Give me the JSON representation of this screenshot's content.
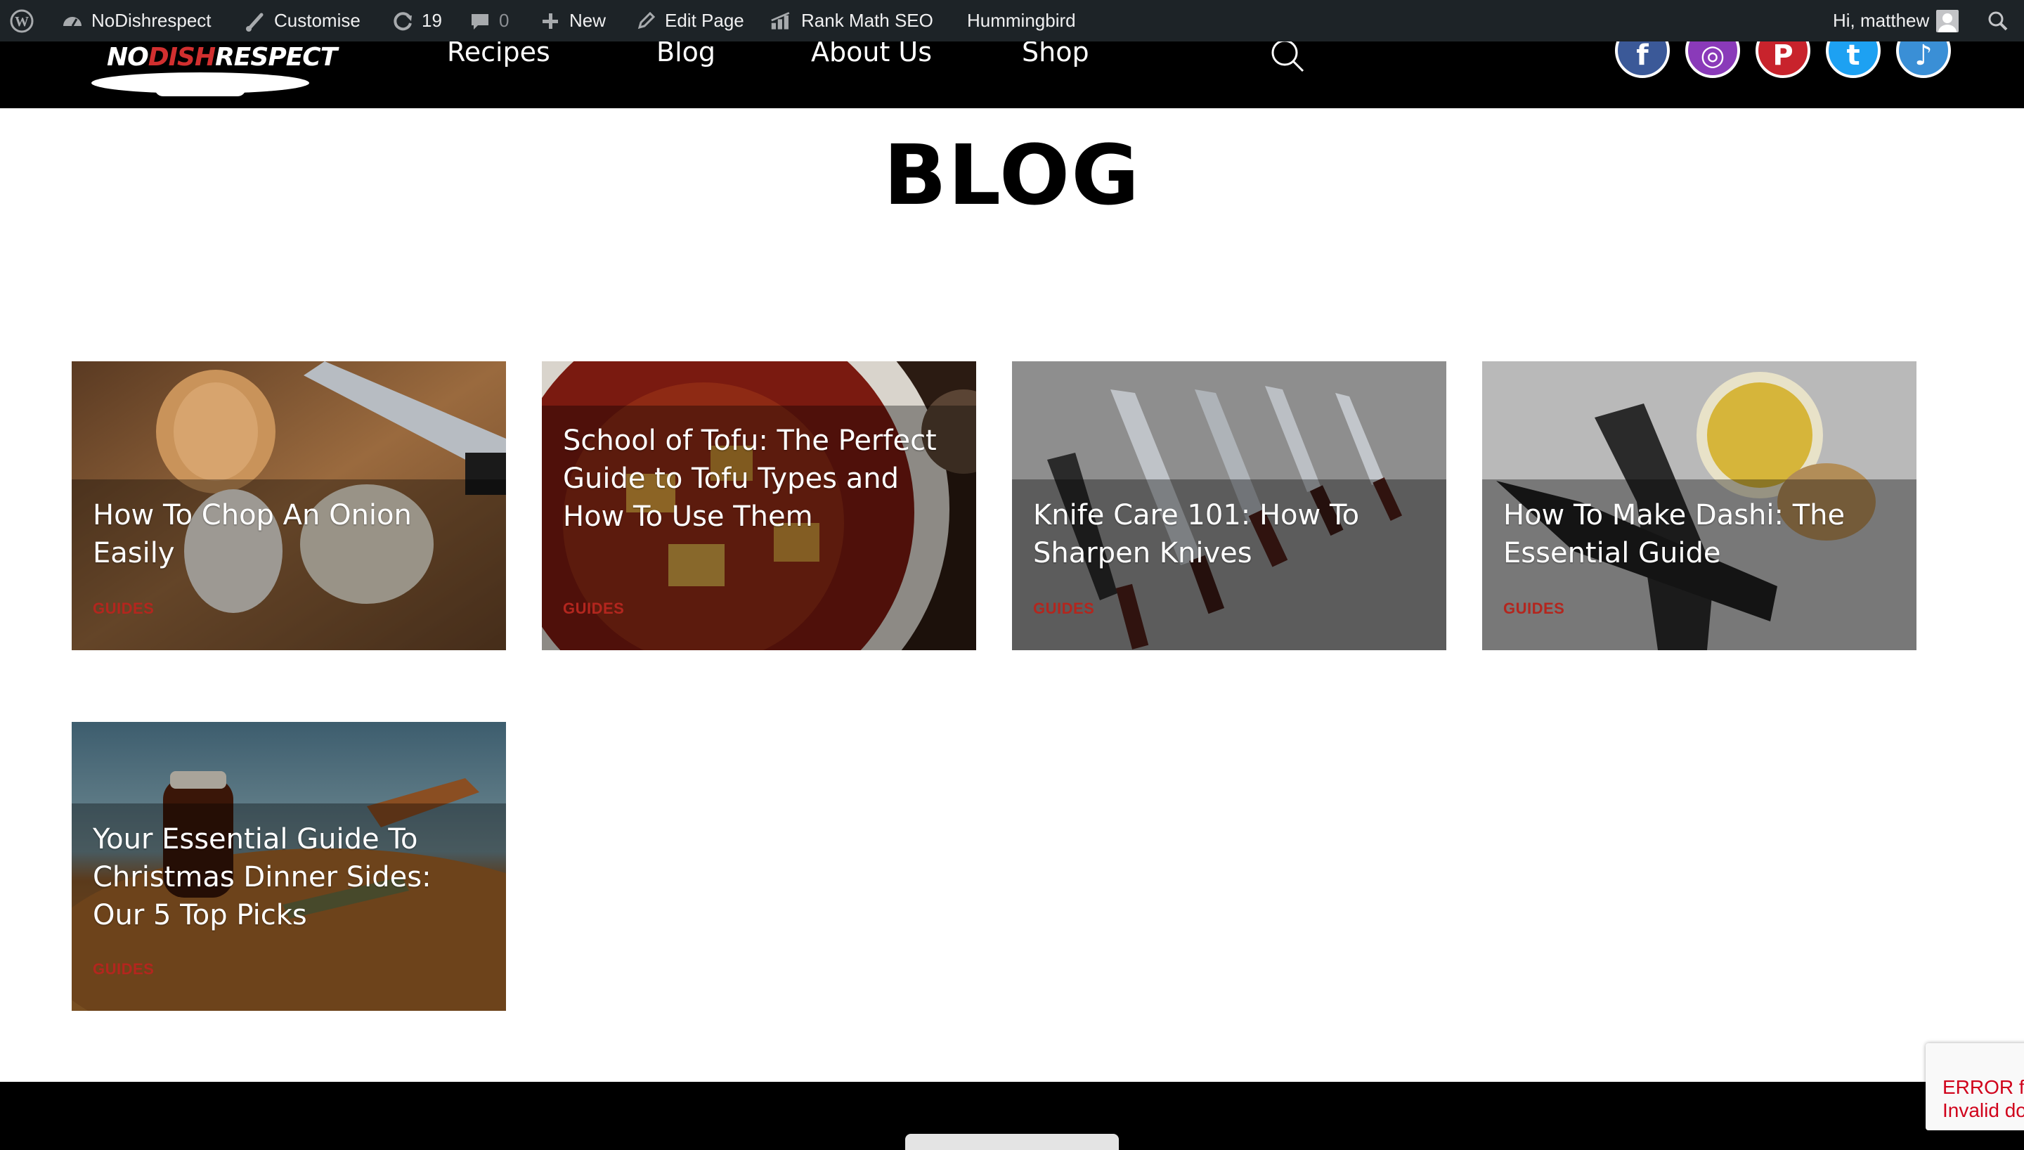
{
  "admin_bar": {
    "site_name": "NoDishrespect",
    "customise": "Customise",
    "updates_count": "19",
    "comments_count": "0",
    "new": "New",
    "edit_page": "Edit Page",
    "rank_math": "Rank Math SEO",
    "hummingbird": "Hummingbird",
    "greeting": "Hi, matthew"
  },
  "header": {
    "logo": {
      "part1": "NO",
      "part2": "DISH",
      "part3": "RESPECT"
    },
    "nav": [
      "Recipes",
      "Blog",
      "About Us",
      "Shop"
    ],
    "social": [
      {
        "name": "facebook",
        "glyph": "f",
        "color": "#3b5998"
      },
      {
        "name": "instagram",
        "glyph": "◎",
        "color": "#8a3ab9"
      },
      {
        "name": "pinterest",
        "glyph": "P",
        "color": "#c8232c"
      },
      {
        "name": "twitter",
        "glyph": "t",
        "color": "#1da1f2"
      },
      {
        "name": "tiktok",
        "glyph": "♪",
        "color": "#3a8fd6"
      }
    ]
  },
  "page": {
    "title": "BLOG"
  },
  "posts": [
    {
      "title": "How To Chop An Onion Easily",
      "category": "GUIDES"
    },
    {
      "title": "School of Tofu: The Perfect Guide to Tofu Types and How To Use Them",
      "category": "GUIDES"
    },
    {
      "title": "Knife Care 101: How To Sharpen Knives",
      "category": "GUIDES"
    },
    {
      "title": "How To Make Dashi: The Essential Guide",
      "category": "GUIDES"
    },
    {
      "title": "Your Essential Guide To Christmas Dinner Sides: Our 5 Top Picks",
      "category": "GUIDES"
    }
  ],
  "recaptcha": {
    "line1": "ERROR fo",
    "line2": "Invalid do"
  },
  "colors": {
    "admin_bar": "#1d2327",
    "header": "#000000",
    "category": "#b3261e"
  }
}
